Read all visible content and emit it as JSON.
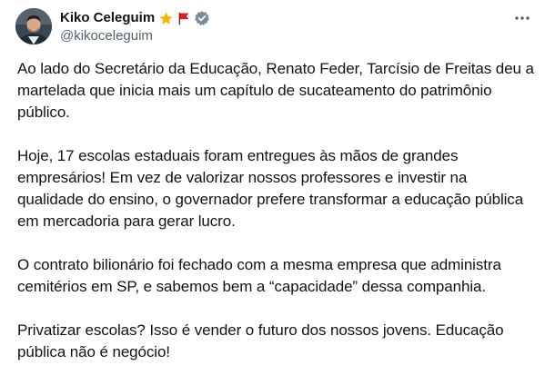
{
  "author": {
    "display_name": "Kiko Celeguim",
    "handle": "@kikoceleguim",
    "badges": [
      "star-icon",
      "red-flag-icon",
      "verified-badge-icon"
    ]
  },
  "colors": {
    "text": "#0f1419",
    "secondary": "#536471",
    "star": "#f5b400",
    "flag": "#d8212b",
    "verified": "#7d8b97"
  },
  "tweet": {
    "paragraphs": [
      "Ao lado do Secretário da Educação, Renato Feder, Tarcísio de Freitas deu a martelada que inicia mais um capítulo de sucateamento do patrimônio público.",
      "Hoje, 17 escolas estaduais foram entregues às mãos de grandes empresários! Em vez de valorizar nossos professores e investir na qualidade do ensino, o governador prefere transformar a educação pública em mercadoria para gerar lucro.",
      "O contrato bilionário foi fechado com a mesma empresa que administra cemitérios em SP, e sabemos bem a “capacidade” dessa companhia.",
      "Privatizar escolas? Isso é vender o futuro dos nossos jovens. Educação pública não é negócio!"
    ]
  }
}
